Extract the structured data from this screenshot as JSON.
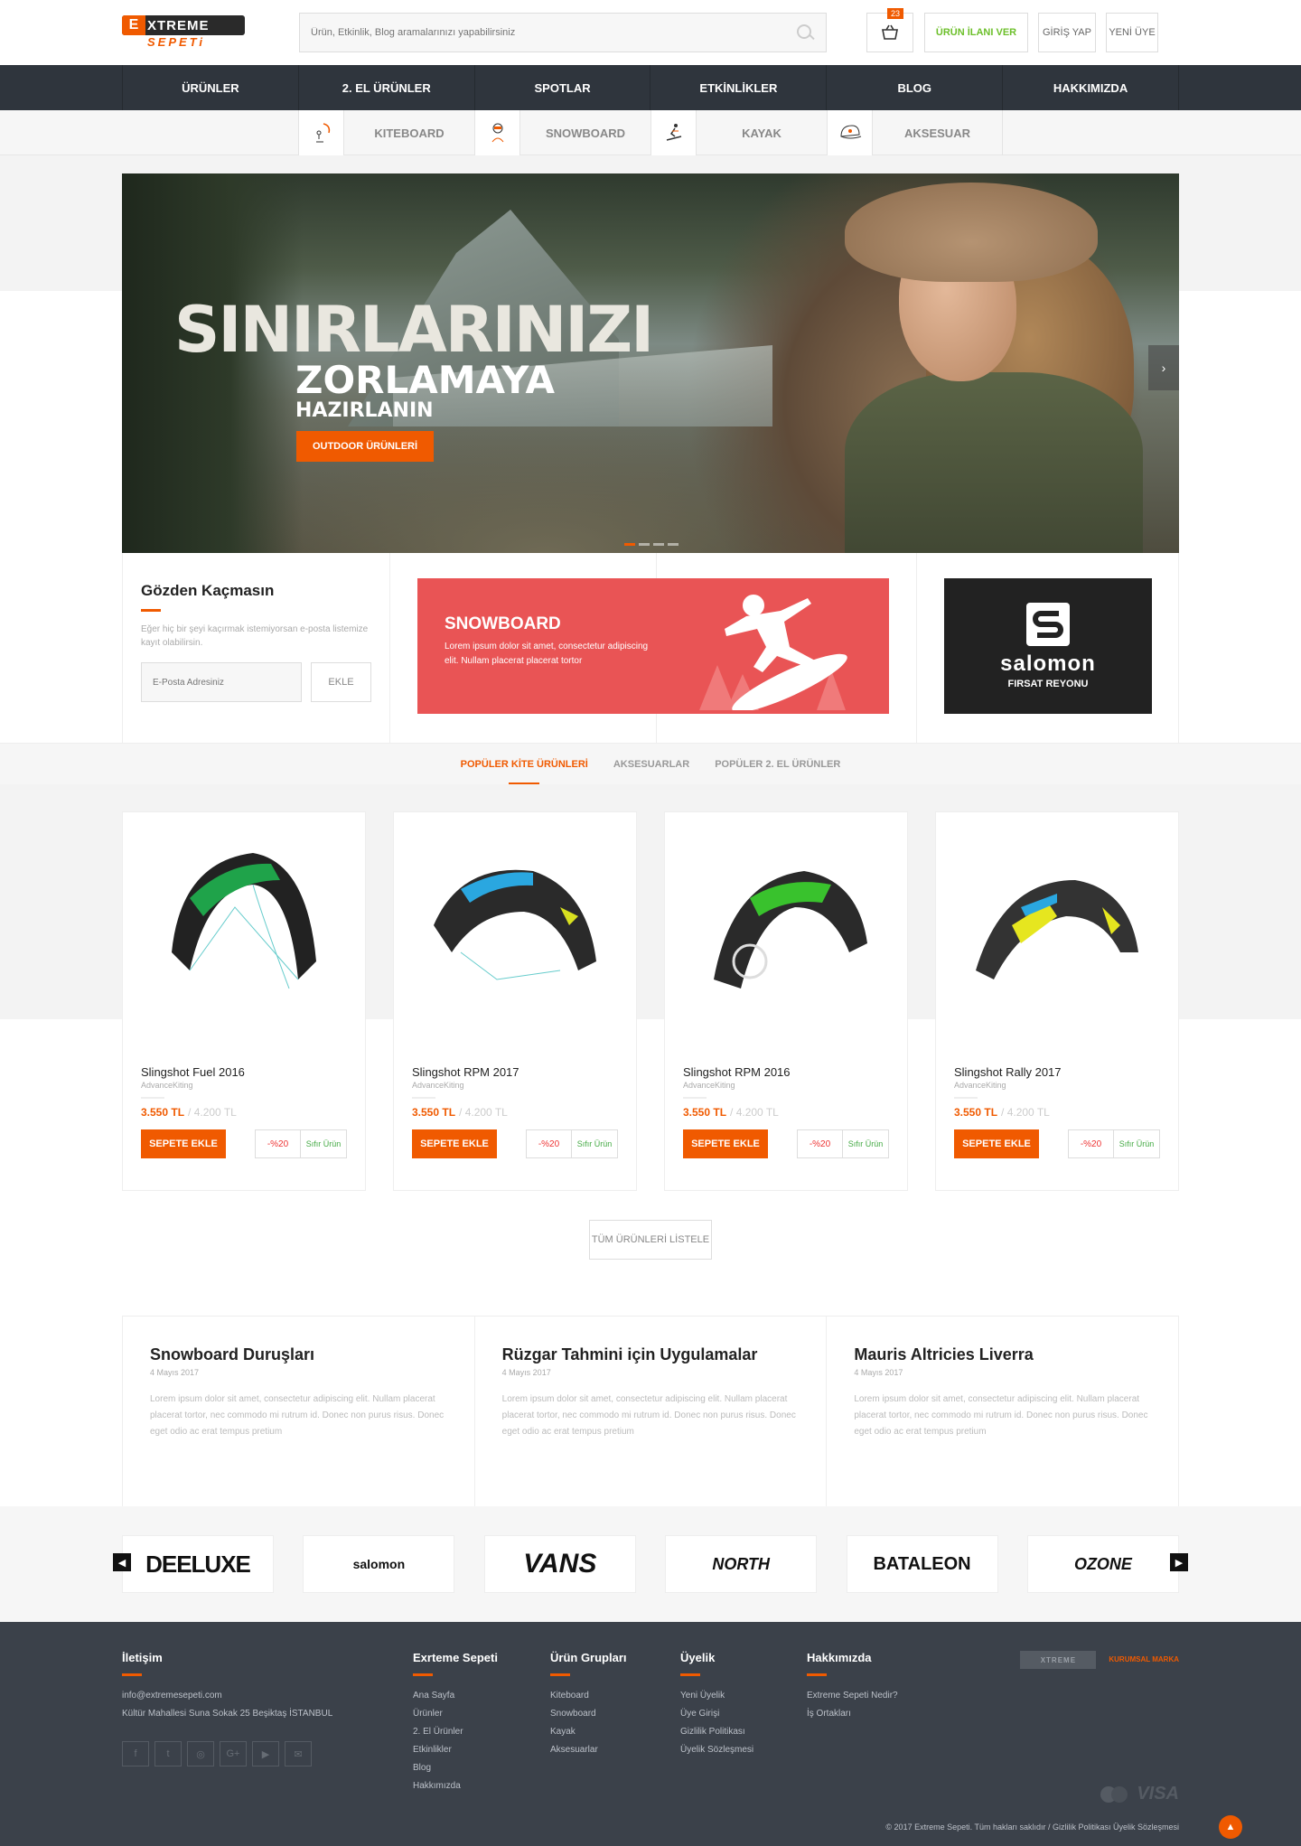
{
  "header": {
    "logo_top": "XTREME",
    "logo_e": "E",
    "logo_bottom": "SEPETi",
    "search_placeholder": "Ürün, Etkinlik, Blog aramalarınızı yapabilirsiniz",
    "cart_count": "23",
    "post_ad_label": "ÜRÜN İLANI VER",
    "login_label": "GİRİŞ YAP",
    "register_label": "YENİ ÜYE"
  },
  "nav": [
    "ÜRÜNLER",
    "2. EL ÜRÜNLER",
    "SPOTLAR",
    "ETKİNLİKLER",
    "BLOG",
    "HAKKIMIZDA"
  ],
  "subnav": [
    {
      "label": "KITEBOARD",
      "icon": "kiteboard-icon"
    },
    {
      "label": "SNOWBOARD",
      "icon": "snowboard-icon"
    },
    {
      "label": "KAYAK",
      "icon": "ski-icon"
    },
    {
      "label": "AKSESUAR",
      "icon": "cap-icon"
    }
  ],
  "hero": {
    "line1": "SINIRLARINIZI",
    "line2": "ZORLAMAYA",
    "line3": "HAZIRLANIN",
    "cta": "OUTDOOR ÜRÜNLERİ",
    "arrow": "›",
    "active_slide": 1,
    "slide_count": 4
  },
  "newsletter": {
    "title": "Gözden Kaçmasın",
    "text": "Eğer hiç bir şeyi kaçırmak istemiyorsan e-posta listemize kayıt olabilirsin.",
    "placeholder": "E-Posta Adresiniz",
    "button": "EKLE"
  },
  "snowboard_promo": {
    "title": "SNOWBOARD",
    "text": "Lorem ipsum dolor sit amet, consectetur adipiscing elit. Nullam placerat placerat tortor"
  },
  "salomon_promo": {
    "name": "salomon",
    "subtitle": "FIRSAT REYONU"
  },
  "tabs": [
    "POPÜLER KİTE ÜRÜNLERİ",
    "AKSESUARLAR",
    "POPÜLER 2. EL ÜRÜNLER"
  ],
  "products": [
    {
      "name": "Slingshot Fuel 2016",
      "brand": "AdvanceKiting",
      "price": "3.550 TL",
      "old_price": "/ 4.200 TL",
      "add": "SEPETE EKLE",
      "discount": "-%20",
      "condition": "Sıfır Ürün",
      "color": "#1fa34a"
    },
    {
      "name": "Slingshot RPM 2017",
      "brand": "AdvanceKiting",
      "price": "3.550 TL",
      "old_price": "/ 4.200 TL",
      "add": "SEPETE EKLE",
      "discount": "-%20",
      "condition": "Sıfır Ürün",
      "color": "#2aa7e0"
    },
    {
      "name": "Slingshot RPM 2016",
      "brand": "AdvanceKiting",
      "price": "3.550 TL",
      "old_price": "/ 4.200 TL",
      "add": "SEPETE EKLE",
      "discount": "-%20",
      "condition": "Sıfır Ürün",
      "color": "#39c22d"
    },
    {
      "name": "Slingshot Rally 2017",
      "brand": "AdvanceKiting",
      "price": "3.550 TL",
      "old_price": "/ 4.200 TL",
      "add": "SEPETE EKLE",
      "discount": "-%20",
      "condition": "Sıfır Ürün",
      "color": "#e6e61f"
    }
  ],
  "list_all": "TÜM ÜRÜNLERİ LİSTELE",
  "posts": [
    {
      "title": "Snowboard Duruşları",
      "date": "4 Mayıs 2017",
      "text": "Lorem ipsum dolor sit amet, consectetur adipiscing elit. Nullam placerat placerat tortor, nec commodo mi rutrum id. Donec non purus risus. Donec eget odio ac erat tempus pretium"
    },
    {
      "title": "Rüzgar Tahmini için Uygulamalar",
      "date": "4 Mayıs 2017",
      "text": "Lorem ipsum dolor sit amet, consectetur adipiscing elit. Nullam placerat placerat tortor, nec commodo mi rutrum id. Donec non purus risus. Donec eget odio ac erat tempus pretium"
    },
    {
      "title": "Mauris Altricies Liverra",
      "date": "4 Mayıs 2017",
      "text": "Lorem ipsum dolor sit amet, consectetur adipiscing elit. Nullam placerat placerat tortor, nec commodo mi rutrum id. Donec non purus risus. Donec eget odio ac erat tempus pretium"
    }
  ],
  "brands": [
    "DEELUXE",
    "salomon",
    "VANS",
    "NORTH",
    "BATALEON",
    "OZONE"
  ],
  "footer": {
    "contact_title": "İletişim",
    "email": "info@extremesepeti.com",
    "address": "Kültür Mahallesi Suna Sokak 25 Beşiktaş İSTANBUL",
    "cols": [
      {
        "title": "Exrteme Sepeti",
        "links": [
          "Ana Sayfa",
          "Ürünler",
          "2. El Ürünler",
          "Etkinlikler",
          "Blog",
          "Hakkımızda"
        ]
      },
      {
        "title": "Ürün Grupları",
        "links": [
          "Kiteboard",
          "Snowboard",
          "Kayak",
          "Aksesuarlar"
        ]
      },
      {
        "title": "Üyelik",
        "links": [
          "Yeni Üyelik",
          "Üye Girişi",
          "Gizlilik Politikası",
          "Üyelik Sözleşmesi"
        ]
      },
      {
        "title": "Hakkımızda",
        "links": [
          "Extreme Sepeti Nedir?",
          "İş Ortakları"
        ]
      }
    ],
    "copyright": "© 2017 Extreme Sepeti. Tüm hakları saklıdır  /  Gizlilik Politikası    Üyelik Sözleşmesi",
    "card_brand": "VISA",
    "partner": "KURUMSAL MARKA"
  }
}
